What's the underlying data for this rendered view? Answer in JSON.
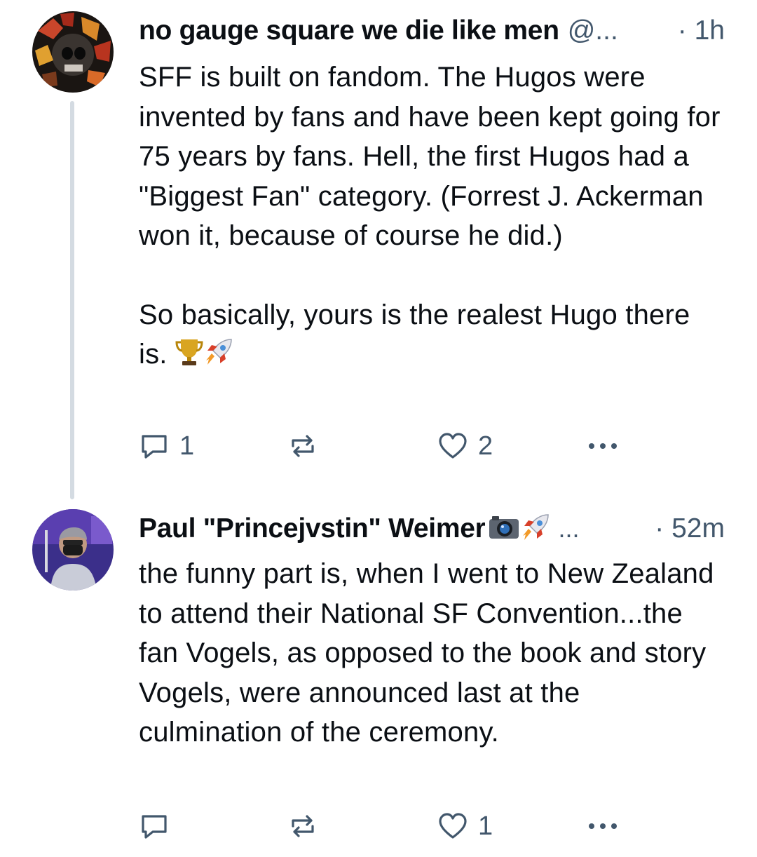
{
  "posts": [
    {
      "author": "no gauge square we die like men",
      "handle": "@...",
      "time": "· 1h",
      "paragraphs": [
        "SFF is built on fandom. The Hugos were invented by fans and have been kept going for 75 years by fans. Hell, the first Hugos had a \"Biggest Fan\" category. (Forrest J. Ackerman won it, because of course he did.)",
        "So basically, yours is the realest Hugo there is."
      ],
      "trailing_emoji": [
        "trophy-icon",
        "rocket-icon"
      ],
      "reply_count": "1",
      "repost_count": "",
      "like_count": "2"
    },
    {
      "author": "Paul \"Princejvstin\" Weimer",
      "author_badges": [
        "camera-icon",
        "rocket-icon"
      ],
      "ellipsis": "...",
      "time": "· 52m",
      "paragraphs": [
        "the funny part is, when I went to New Zealand to attend their National SF Convention...the fan Vogels, as opposed to the book and story Vogels, were announced last at the culmination of the ceremony."
      ],
      "reply_count": "",
      "repost_count": "",
      "like_count": "1"
    }
  ],
  "colors": {
    "text": "#0b0f14",
    "muted": "#42576c",
    "thread_line": "#d4dbe2",
    "background": "#ffffff"
  }
}
